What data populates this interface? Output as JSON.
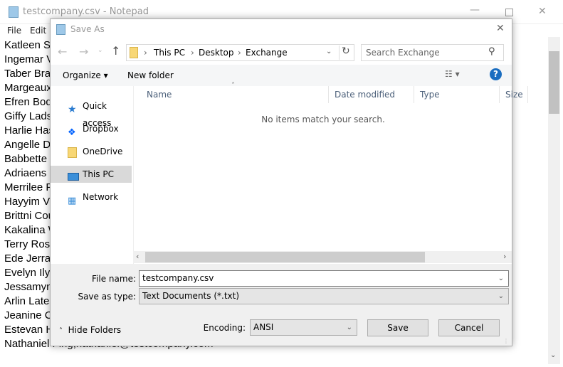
{
  "notepad": {
    "title": "testcompany.csv - Notepad",
    "menu": [
      "File",
      "Edit"
    ],
    "lines": [
      "Katleen Se",
      "Ingemar Vo",
      "Taber Bran",
      "Margeaux",
      "Efren Bode",
      "Giffy Ladso",
      "Harlie Hask",
      "Angelle De",
      "Babbette F",
      "Adriaens D",
      "Merrilee Po",
      "Hayyim Via",
      "Brittni Couc",
      "Kakalina W",
      "Terry Rostr",
      "Ede Jerran",
      "Evelyn Ilya",
      "Jessamyn",
      "Arlin Lates,",
      "Jeanine Ca",
      "Estevan Ha",
      "Nathaniel Fing,nathaniel@testcompany.com"
    ]
  },
  "dialog": {
    "title": "Save As",
    "breadcrumb": [
      "This PC",
      "Desktop",
      "Exchange"
    ],
    "search_placeholder": "Search Exchange",
    "toolbar": {
      "organize": "Organize",
      "new_folder": "New folder"
    },
    "nav": [
      {
        "label": "Quick access",
        "icon": "star-icon"
      },
      {
        "label": "Dropbox",
        "icon": "dropbox-icon"
      },
      {
        "label": "OneDrive",
        "icon": "folder-icon"
      },
      {
        "label": "This PC",
        "icon": "computer-icon",
        "selected": true
      },
      {
        "label": "Network",
        "icon": "network-icon"
      }
    ],
    "columns": [
      "Name",
      "Date modified",
      "Type",
      "Size"
    ],
    "empty_message": "No items match your search.",
    "file_name_label": "File name:",
    "file_name": "testcompany.csv",
    "save_type_label": "Save as type:",
    "save_type": "Text Documents (*.txt)",
    "hide_folders": "Hide Folders",
    "encoding_label": "Encoding:",
    "encoding": "ANSI",
    "save": "Save",
    "cancel": "Cancel"
  },
  "colors": {
    "selected_nav": "#d9d9d9",
    "help": "#1a6dc0",
    "folder": "#f8d775"
  }
}
